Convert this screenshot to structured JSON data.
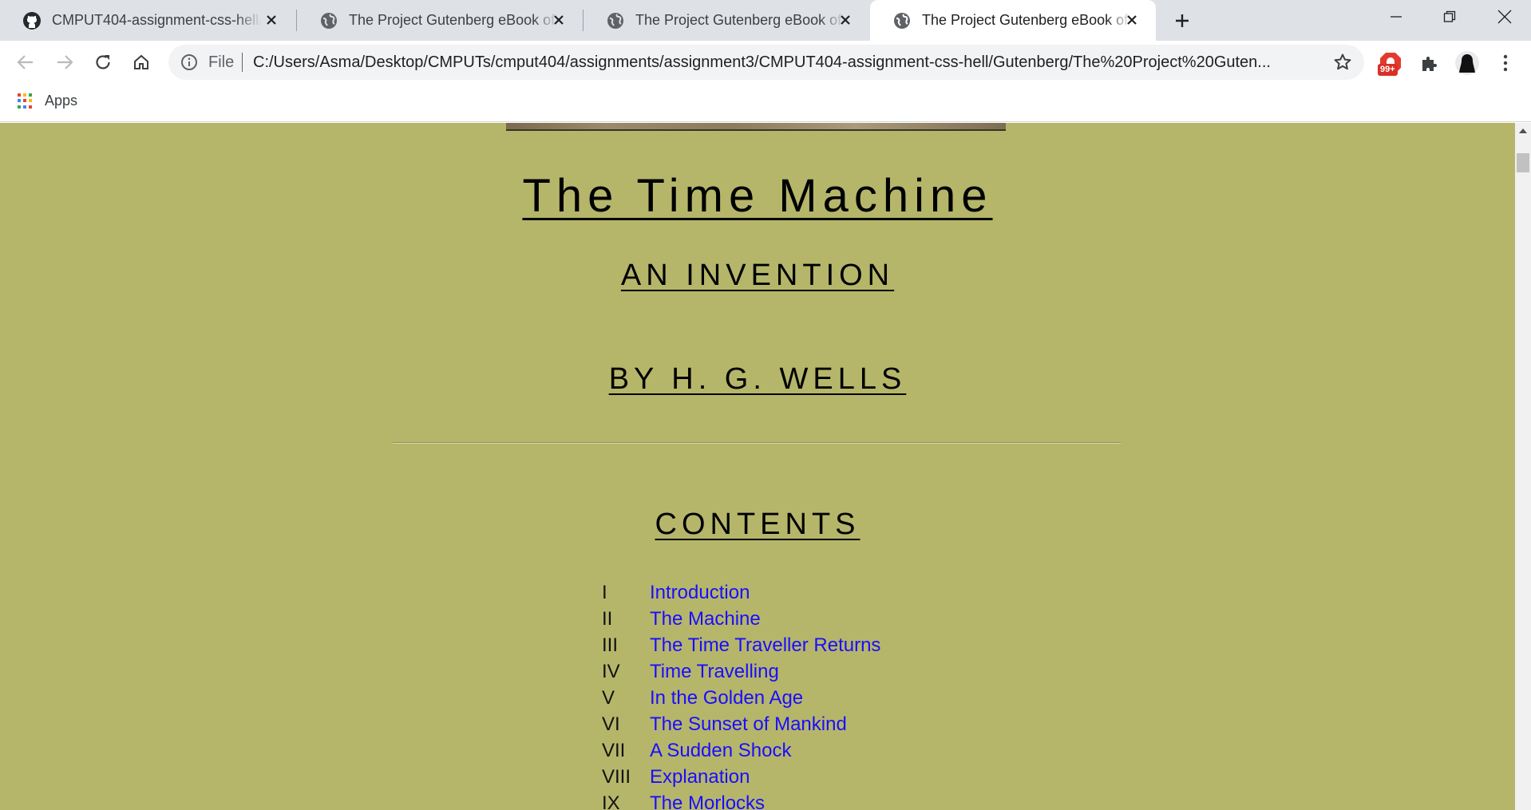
{
  "tabs": [
    {
      "title": "CMPUT404-assignment-css-hell/",
      "icon": "github-icon"
    },
    {
      "title": "The Project Gutenberg eBook of",
      "icon": "globe-icon"
    },
    {
      "title": "The Project Gutenberg eBook of",
      "icon": "globe-icon"
    },
    {
      "title": "The Project Gutenberg eBook of",
      "icon": "globe-icon"
    }
  ],
  "omnibox": {
    "scheme": "File",
    "url": "C:/Users/Asma/Desktop/CMPUTs/cmput404/assignments/assignment3/CMPUT404-assignment-css-hell/Gutenberg/The%20Project%20Guten..."
  },
  "extensions": {
    "badge": "99+"
  },
  "bookmarks": {
    "apps_label": "Apps"
  },
  "page": {
    "title": "The Time Machine",
    "subtitle": "AN INVENTION",
    "author": "BY H. G. WELLS",
    "contents_heading": "CONTENTS",
    "contents": [
      {
        "num": "I",
        "label": "Introduction"
      },
      {
        "num": "II",
        "label": "The Machine"
      },
      {
        "num": "III",
        "label": "The Time Traveller Returns"
      },
      {
        "num": "IV",
        "label": "Time Travelling"
      },
      {
        "num": "V",
        "label": "In the Golden Age"
      },
      {
        "num": "VI",
        "label": "The Sunset of Mankind"
      },
      {
        "num": "VII",
        "label": "A Sudden Shock"
      },
      {
        "num": "VIII",
        "label": "Explanation"
      },
      {
        "num": "IX",
        "label": "The Morlocks"
      }
    ]
  },
  "colors": {
    "page_background": "#b5b66a",
    "link": "#1a0dff",
    "tabstrip": "#dee1e6"
  }
}
